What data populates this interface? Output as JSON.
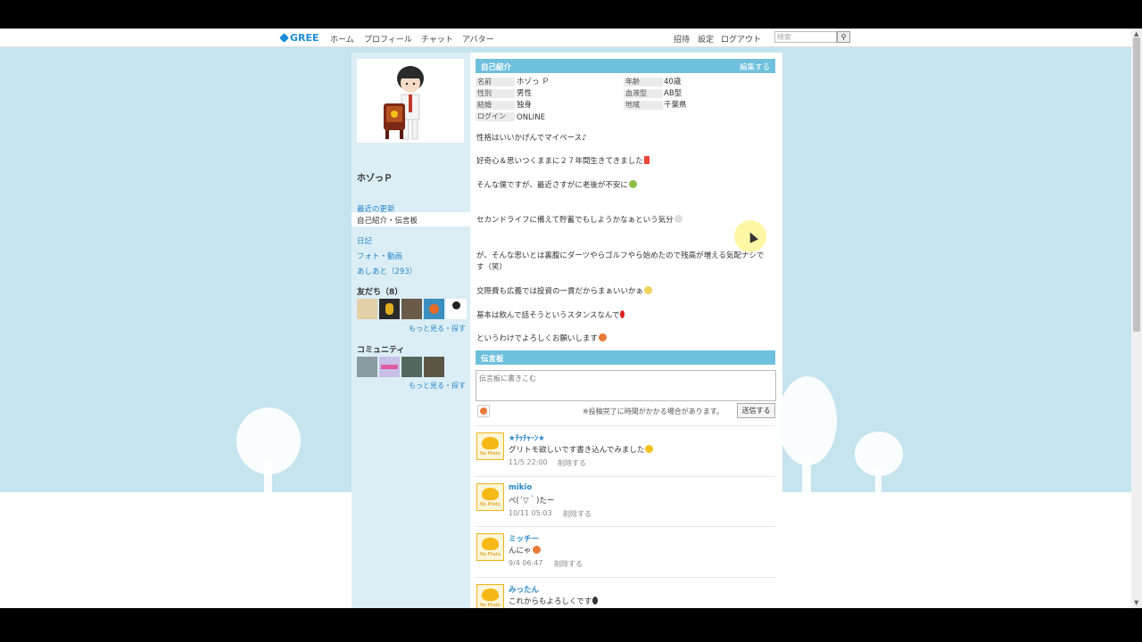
{
  "topbar": {
    "logo": "GREE",
    "nav": [
      "ホーム",
      "プロフィール",
      "チャット",
      "アバター"
    ],
    "right_links": [
      "招待",
      "設定",
      "ログアウト"
    ],
    "search_placeholder": "検索"
  },
  "sidebar": {
    "user_name": "ホゾっＰ",
    "links": {
      "recent": "最近の更新",
      "intro_board": "自己紹介・伝言板",
      "diary": "日記",
      "photo": "フォト・動画",
      "footprints": "あしあと（293）"
    },
    "friends_heading": "友だち（8）",
    "friends_more": "もっと見る・探す",
    "community_heading": "コミュニティ",
    "community_more": "もっと見る・探す"
  },
  "profile": {
    "heading": "自己紹介",
    "edit_link": "編集する",
    "rows_left": [
      {
        "label": "名前",
        "value": "ホゾっ Ｐ"
      },
      {
        "label": "性別",
        "value": "男性"
      },
      {
        "label": "結婚",
        "value": "独身"
      },
      {
        "label": "ログイン",
        "value": "ONLINE"
      }
    ],
    "rows_right": [
      {
        "label": "年齢",
        "value": "40歳"
      },
      {
        "label": "血液型",
        "value": "AB型"
      },
      {
        "label": "地域",
        "value": "千葉県"
      }
    ],
    "intro_lines": [
      "性格はいいかげんでマイペース♪",
      "好奇心＆思いつくままに２７年間生きてきました",
      "そんな僕ですが、最近さすがに老後が不安に",
      "セカンドライフに備えて貯蓄でもしようかなぁという気分",
      "が、そんな思いとは裏腹にダーツやらゴルフやら始めたので残高が増える気配ナシで",
      "す（笑）",
      "交際費も広義では投資の一貫だからまぁいいかぁ",
      "基本は飲んで話そうというスタンスなんで",
      "というわけでよろしくお願いします"
    ]
  },
  "board": {
    "heading": "伝言板",
    "placeholder": "伝言板に書きこむ",
    "note": "※投稿完了に時間がかかる場合があります。",
    "send_label": "送信する",
    "posts": [
      {
        "name": "★ﾁｯﾁｬｰﾝ★",
        "text": "グリトモ欲しいです書き込んでみました",
        "date": "11/5 22:00",
        "delete": "削除する"
      },
      {
        "name": "mikio",
        "text": "ぺ(´▽｀)たー",
        "date": "10/11 05:03",
        "delete": "削除する"
      },
      {
        "name": "ミッチー",
        "text": "んにゃ",
        "date": "9/4 06:47",
        "delete": "削除する"
      },
      {
        "name": "みったん",
        "text": "これからもよろしくです",
        "date": "",
        "delete": ""
      }
    ],
    "no_photo_label": "No Photo"
  },
  "colors": {
    "accent": "#6fc0dd",
    "link": "#2a88c8",
    "sky": "#c6e4ee"
  }
}
